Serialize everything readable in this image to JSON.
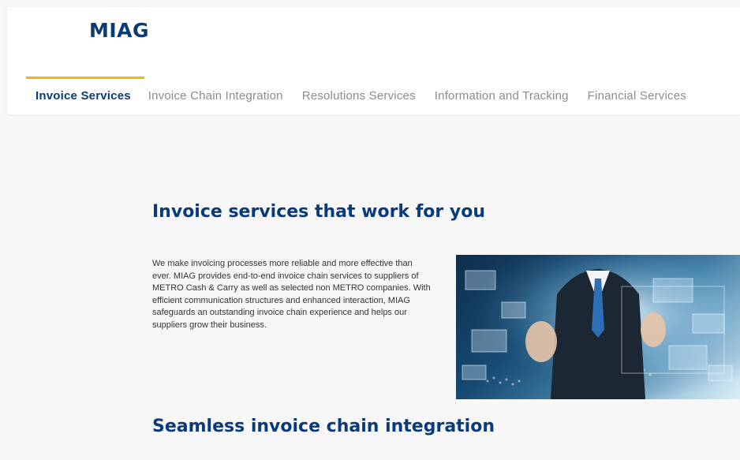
{
  "header": {
    "logo": "MIAG",
    "nav": [
      {
        "label": "Invoice Services",
        "active": true
      },
      {
        "label": "Invoice Chain Integration",
        "active": false
      },
      {
        "label": "Resolutions Services",
        "active": false
      },
      {
        "label": "Information and Tracking",
        "active": false
      },
      {
        "label": "Financial Services",
        "active": false
      }
    ]
  },
  "main": {
    "heading": "Invoice services that work for you",
    "intro": "We make invoicing processes more reliable and more effective than ever. MIAG provides end-to-end invoice chain services to suppliers of METRO Cash & Carry as well as selected non METRO companies. With efficient communication structures and enhanced interaction, MIAG safeguards an outstanding invoice chain experience and helps our suppliers grow their business.",
    "section_heading": "Seamless invoice chain integration"
  },
  "colors": {
    "brand": "#0b3a78",
    "accent": "#f2b705",
    "nav_inactive": "#8c8c8c",
    "background": "#f7f7f7"
  }
}
